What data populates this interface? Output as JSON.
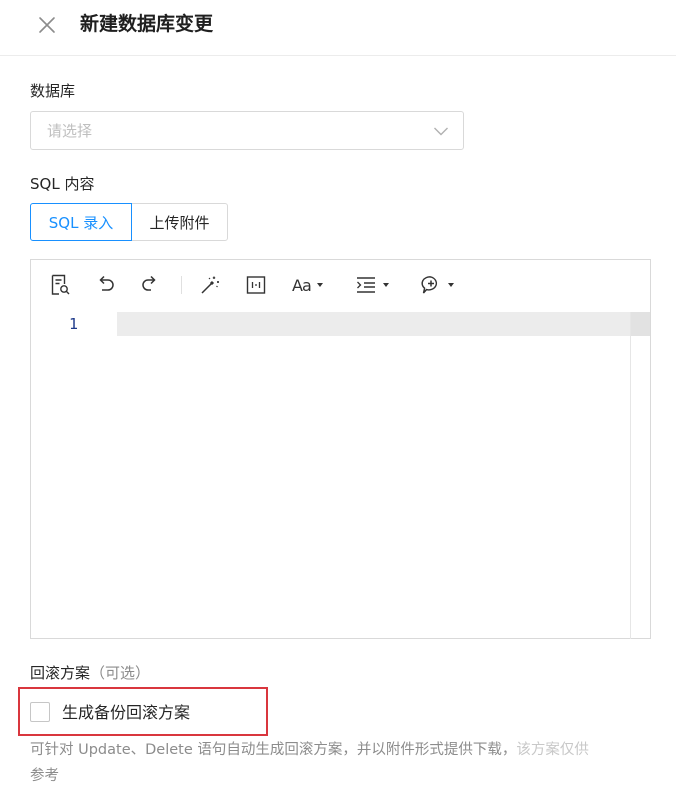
{
  "header": {
    "title": "新建数据库变更",
    "close_icon": "close-icon"
  },
  "database": {
    "label": "数据库",
    "placeholder": "请选择",
    "icon": "chevron-down-icon"
  },
  "sql": {
    "label": "SQL 内容",
    "tabs": [
      {
        "label": "SQL 录入",
        "active": true
      },
      {
        "label": "上传附件",
        "active": false
      }
    ]
  },
  "editor": {
    "toolbar_icons": [
      "format-document-icon",
      "undo-icon",
      "redo-icon",
      "magic-wand-icon",
      "column-layout-icon",
      "font-size-icon",
      "indent-icon",
      "comment-icon"
    ],
    "font_label": "Aa",
    "line_numbers": [
      "1"
    ],
    "content": ""
  },
  "rollback": {
    "label": "回滚方案",
    "optional": "（可选）",
    "checkbox_label": "生成备份回滚方案",
    "checked": false,
    "helper_main": "可针对 Update、Delete 语句自动生成回滚方案，并以附件形式提供下载，",
    "helper_faded": "该方案仅供",
    "helper_end": "参考"
  },
  "colors": {
    "accent": "#1890ff",
    "highlight_border": "#d9363e",
    "line_number": "#1e3a8a"
  }
}
